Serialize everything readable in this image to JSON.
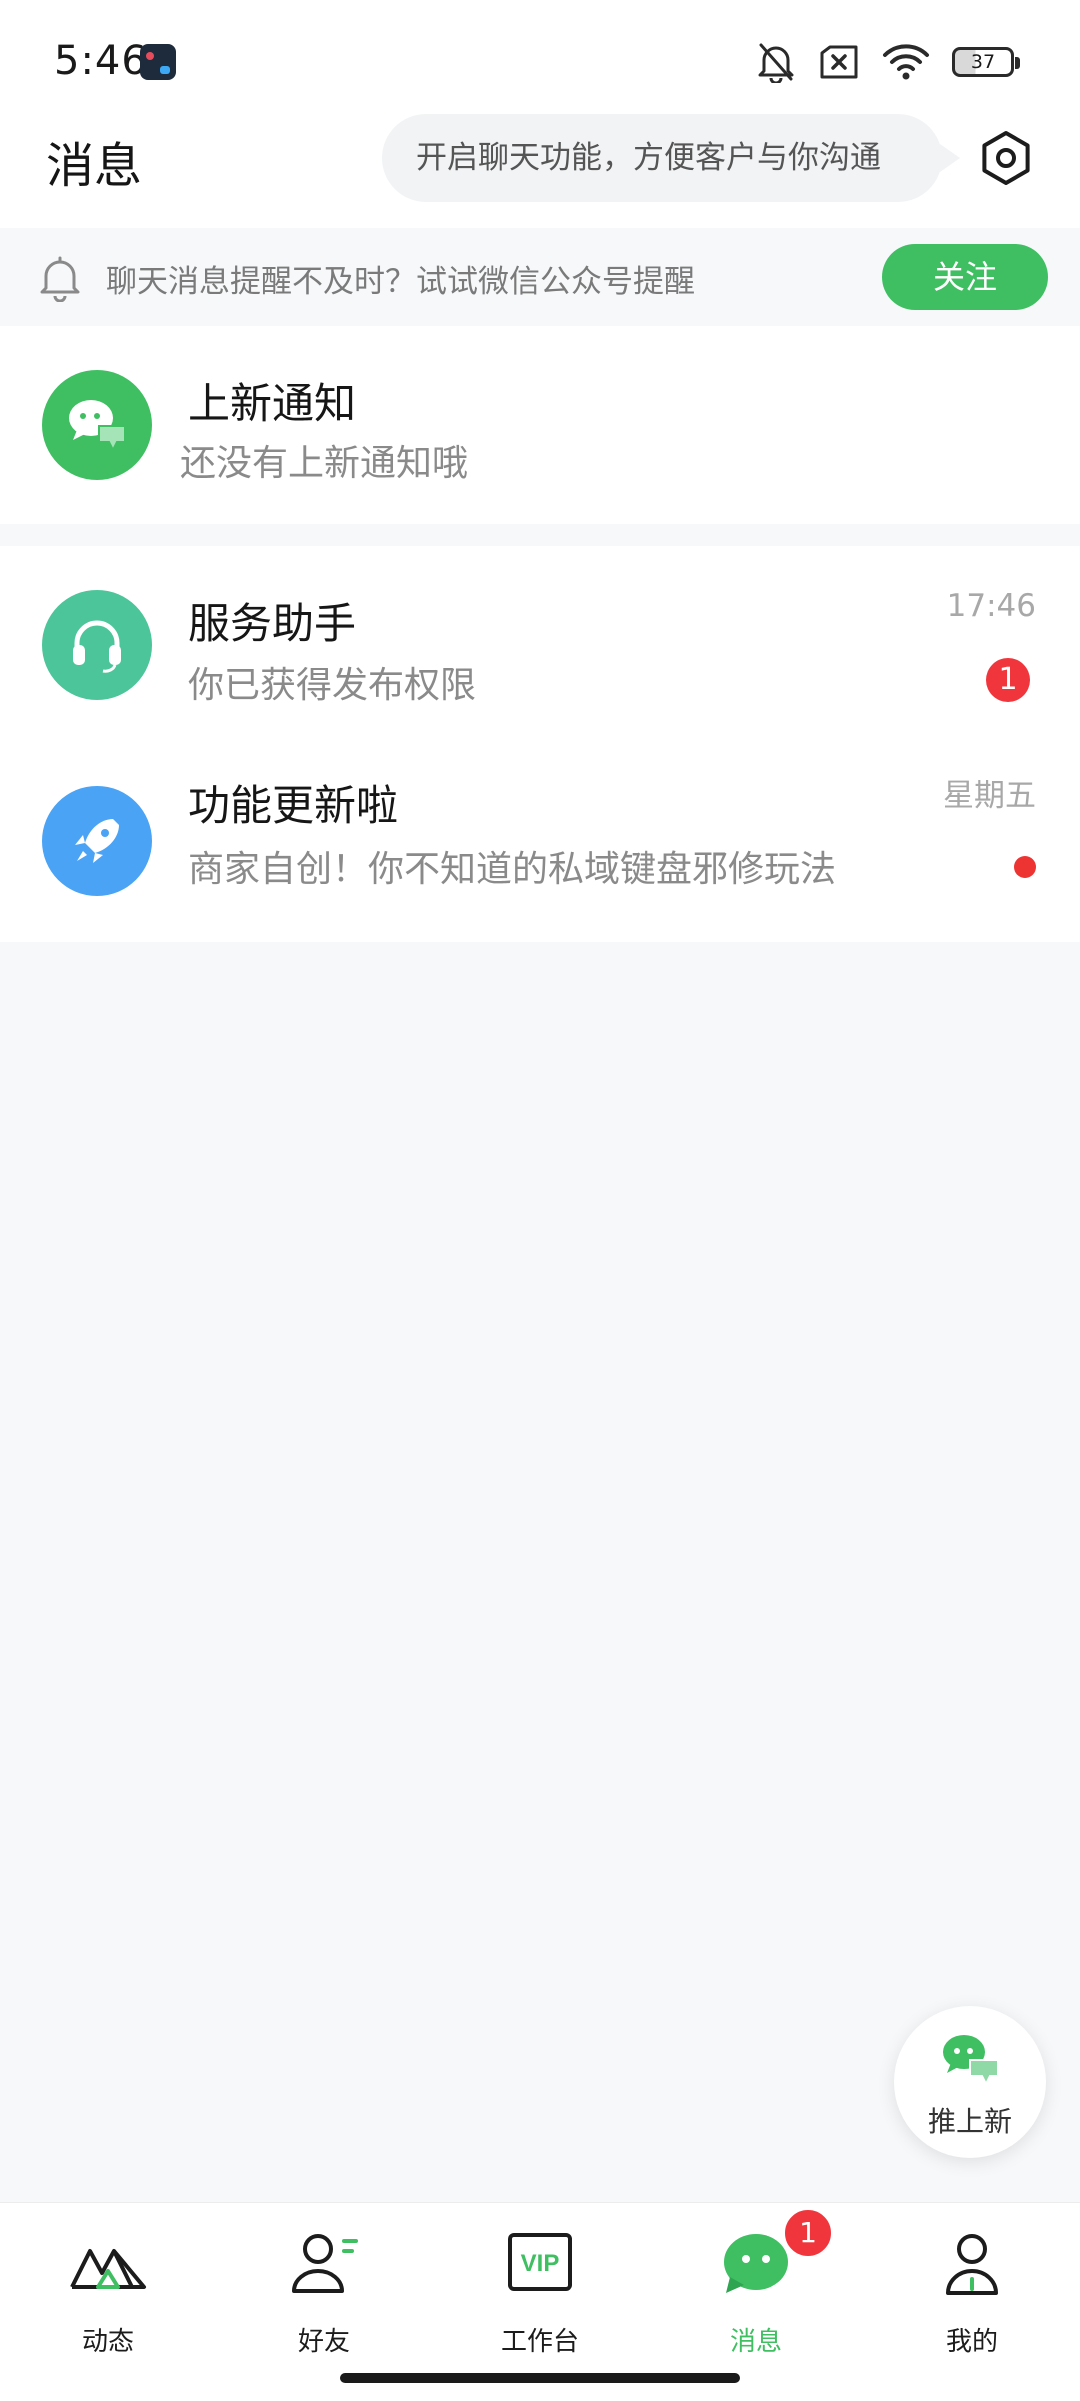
{
  "status_bar": {
    "time": "5:46",
    "battery": "37"
  },
  "header": {
    "title": "消息",
    "chat_tip": "开启聊天功能，方便客户与你沟通"
  },
  "notice": {
    "text": "聊天消息提醒不及时？试试微信公众号提醒",
    "follow_label": "关注"
  },
  "new_notice": {
    "title": "上新通知",
    "subtitle": "还没有上新通知哦"
  },
  "conversations": [
    {
      "title": "服务助手",
      "subtitle": "你已获得发布权限",
      "time": "17:46",
      "badge": "1"
    },
    {
      "title": "功能更新啦",
      "subtitle": "商家自创！你不知道的私域键盘邪修玩法",
      "time": "星期五"
    }
  ],
  "fab": {
    "label": "推上新"
  },
  "tabs": [
    {
      "label": "动态"
    },
    {
      "label": "好友"
    },
    {
      "label": "工作台",
      "icon_text": "VIP"
    },
    {
      "label": "消息",
      "badge": "1"
    },
    {
      "label": "我的"
    }
  ],
  "colors": {
    "accent": "#3fbf62",
    "badge": "#f0363c",
    "service_avatar": "#4cc59a",
    "update_avatar": "#4aa3f5"
  }
}
